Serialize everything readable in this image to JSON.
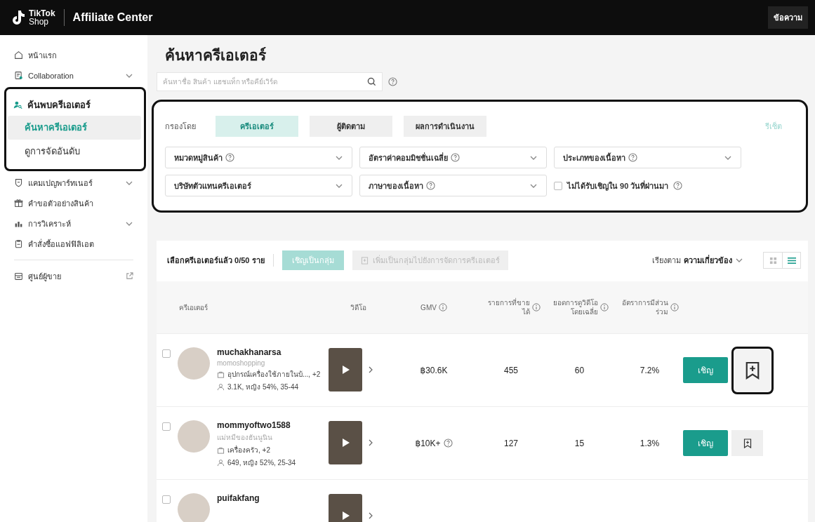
{
  "header": {
    "logo_line1": "TikTok",
    "logo_line2": "Shop",
    "title": "Affiliate Center",
    "right_link": "ข้อความ"
  },
  "sidebar": {
    "items": [
      {
        "kind": "plain",
        "label": "หน้าแรก"
      },
      {
        "kind": "submenu",
        "label": "Collaboration",
        "expanded": false
      },
      {
        "kind": "group",
        "label": "ค้นพบครีเอเตอร์",
        "highlighted": true,
        "children": [
          {
            "label": "ค้นหาครีเอเตอร์",
            "selected": true
          },
          {
            "label": "ดูการจัดอันดับ",
            "selected": false
          }
        ]
      },
      {
        "kind": "submenu",
        "label": "แคมเปญพาร์ทเนอร์",
        "expanded": false
      },
      {
        "kind": "plain",
        "label": "คำขอตัวอย่างสินค้า"
      },
      {
        "kind": "submenu",
        "label": "การวิเคราะห์",
        "expanded": false
      },
      {
        "kind": "plain",
        "label": "คำสั่งซื้อแอฟฟิลิเอต"
      },
      {
        "kind": "external",
        "label": "ศูนย์ผู้ขาย"
      }
    ]
  },
  "page_title": "ค้นหาครีเอเตอร์",
  "search": {
    "placeholder": "ค้นหาชื่อ สินค้า แฮชแท็ก หรือคีย์เวิร์ด"
  },
  "filter": {
    "highlighted": true,
    "label": "กรองโดย",
    "reset": "รีเซ็ต",
    "tabs": [
      {
        "label": "ครีเอเตอร์",
        "selected": true
      },
      {
        "label": "ผู้ติดตาม",
        "selected": false
      },
      {
        "label": "ผลการดำเนินงาน",
        "selected": false
      }
    ],
    "dropdowns": [
      {
        "label": "หมวดหมู่สินค้า",
        "help": true
      },
      {
        "label": "อัตราค่าคอมมิชชั่นเฉลี่ย",
        "help": true
      },
      {
        "label": "ประเภทของเนื้อหา",
        "help": true
      },
      {
        "label": "บริษัทตัวแทนครีเอเตอร์",
        "help": false
      },
      {
        "label": "ภาษาของเนื้อหา",
        "help": true
      }
    ],
    "checkbox": {
      "label": "ไม่ได้รับเชิญใน 90 วันที่ผ่านมา",
      "checked": false
    }
  },
  "list": {
    "selected_count": "เลือกครีเอเตอร์แล้ว 0/50 ราย",
    "bulk_invite": {
      "label": "เชิญเป็นกลุ่ม",
      "disabled": true
    },
    "add_group": {
      "label": "เพิ่มเป็นกลุ่มไปยังการจัดการครีเอเตอร์",
      "disabled": true
    },
    "sort_label": "เรียงตาม",
    "sort_value": "ความเกี่ยวข้อง",
    "view_modes": [
      {
        "selected": false
      },
      {
        "selected": true
      }
    ],
    "columns": [
      {
        "label": "ครีเอเตอร์",
        "info": false
      },
      {
        "label": "วิดีโอ",
        "info": false
      },
      {
        "label": "GMV",
        "info": true
      },
      {
        "label": "รายการที่ขายได้",
        "info": true
      },
      {
        "label": "ยอดการดูวิดีโอโดยเฉลี่ย",
        "info": true
      },
      {
        "label": "อัตราการมีส่วนร่วม",
        "info": true
      }
    ],
    "rows": [
      {
        "checked": false,
        "name": "muchakhanarsa",
        "handle": "momoshopping",
        "category": "อุปกรณ์เครื่องใช้ภายในบ้...,  +2",
        "audience": "3.1K, หญิง 54%, 35-44",
        "gmv": "฿30.6K",
        "gmv_info": false,
        "sold": "455",
        "views": "60",
        "engagement": "7.2%",
        "invite": "เชิญ",
        "bookmark_highlighted": true
      },
      {
        "checked": false,
        "name": "mommyoftwo1588",
        "handle": "แม่หมีของฮันนูนิน",
        "category": "เครื่องครัว, +2",
        "audience": "649, หญิง 52%, 25-34",
        "gmv": "฿10K+",
        "gmv_info": true,
        "sold": "127",
        "views": "15",
        "engagement": "1.3%",
        "invite": "เชิญ",
        "bookmark_highlighted": false
      },
      {
        "checked": false,
        "name": "puifakfang"
      }
    ]
  }
}
